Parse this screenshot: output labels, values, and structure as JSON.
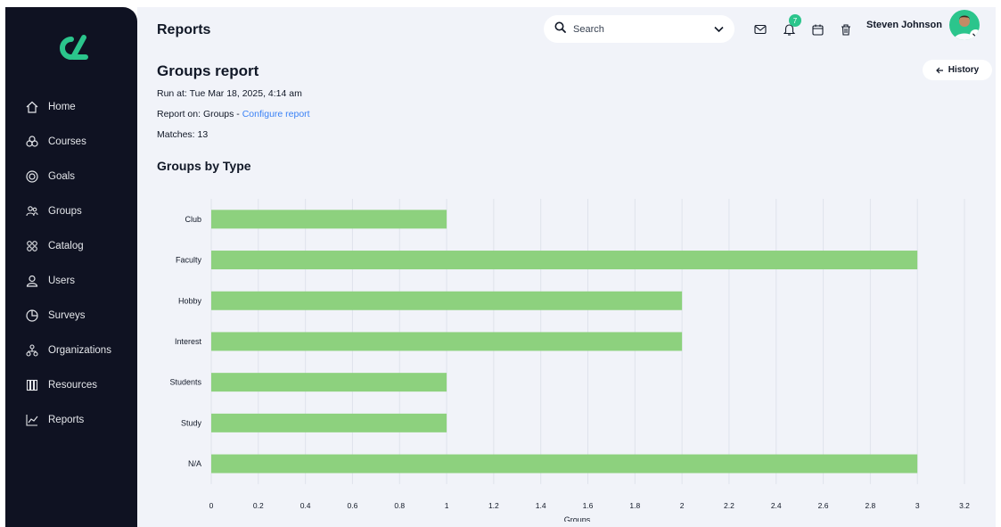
{
  "app": {
    "logo_icon": "brand-logo-icon",
    "accent": "#2bc58c"
  },
  "sidebar": {
    "items": [
      {
        "label": "Home",
        "icon": "home-icon"
      },
      {
        "label": "Courses",
        "icon": "courses-icon"
      },
      {
        "label": "Goals",
        "icon": "goals-icon"
      },
      {
        "label": "Groups",
        "icon": "groups-icon"
      },
      {
        "label": "Catalog",
        "icon": "catalog-icon"
      },
      {
        "label": "Users",
        "icon": "user-icon"
      },
      {
        "label": "Surveys",
        "icon": "surveys-icon"
      },
      {
        "label": "Organizations",
        "icon": "organizations-icon"
      },
      {
        "label": "Resources",
        "icon": "resources-icon"
      },
      {
        "label": "Reports",
        "icon": "reports-icon"
      }
    ]
  },
  "header": {
    "title": "Reports",
    "search_placeholder": "Search",
    "notification_count": "7",
    "user_name": "Steven Johnson"
  },
  "report": {
    "title": "Groups report",
    "run_at": "Run at: Tue Mar 18, 2025, 4:14 am",
    "report_on_prefix": "Report on: Groups - ",
    "configure_link": "Configure report",
    "matches": "Matches: 13",
    "history_label": "History",
    "section_title": "Groups by Type"
  },
  "chart_data": {
    "type": "bar",
    "orientation": "horizontal",
    "categories": [
      "Club",
      "Faculty",
      "Hobby",
      "Interest",
      "Students",
      "Study",
      "N/A"
    ],
    "values": [
      1,
      3,
      2,
      2,
      1,
      1,
      3
    ],
    "xlabel": "Groups",
    "ylabel": "",
    "xlim": [
      0,
      3.2
    ],
    "xticks": [
      "0",
      "0.2",
      "0.4",
      "0.6",
      "0.8",
      "1",
      "1.2",
      "1.4",
      "1.6",
      "1.8",
      "2",
      "2.2",
      "2.4",
      "2.6",
      "2.8",
      "3",
      "3.2"
    ],
    "bar_color": "#8dd17e",
    "grid": "vertical"
  }
}
